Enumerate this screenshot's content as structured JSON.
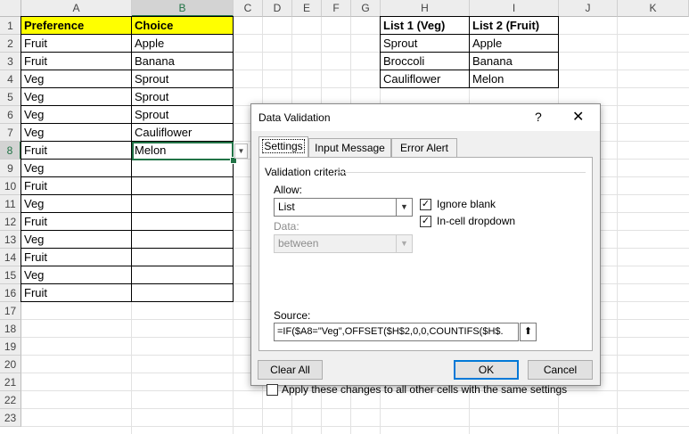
{
  "columns": [
    "A",
    "B",
    "C",
    "D",
    "E",
    "F",
    "G",
    "H",
    "I",
    "J",
    "K"
  ],
  "selected_column": "B",
  "selected_row": 8,
  "rows": [
    1,
    2,
    3,
    4,
    5,
    6,
    7,
    8,
    9,
    10,
    11,
    12,
    13,
    14,
    15,
    16,
    17,
    18,
    19,
    20,
    21,
    22,
    23
  ],
  "sheet": {
    "A1": "Preference",
    "B1": "Choice",
    "A2": "Fruit",
    "B2": "Apple",
    "A3": "Fruit",
    "B3": "Banana",
    "A4": "Veg",
    "B4": "Sprout",
    "A5": "Veg",
    "B5": "Sprout",
    "A6": "Veg",
    "B6": "Sprout",
    "A7": "Veg",
    "B7": "Cauliflower",
    "A8": "Fruit",
    "B8": "Melon",
    "A9": "Veg",
    "A10": "Fruit",
    "A11": "Veg",
    "A12": "Fruit",
    "A13": "Veg",
    "A14": "Fruit",
    "A15": "Veg",
    "A16": "Fruit",
    "H1": "List 1 (Veg)",
    "I1": "List 2 (Fruit)",
    "H2": "Sprout",
    "I2": "Apple",
    "H3": "Broccoli",
    "I3": "Banana",
    "H4": "Cauliflower",
    "I4": "Melon"
  },
  "dialog": {
    "title": "Data Validation",
    "help": "?",
    "close": "✕",
    "tabs": [
      "Settings",
      "Input Message",
      "Error Alert"
    ],
    "active_tab": "Settings",
    "group_label": "Validation criteria",
    "allow_label": "Allow:",
    "allow_value": "List",
    "data_label": "Data:",
    "data_value": "between",
    "ignore_blank_label": "Ignore blank",
    "ignore_blank_checked": true,
    "in_cell_dropdown_label": "In-cell dropdown",
    "in_cell_dropdown_checked": true,
    "source_label": "Source:",
    "source_value": "=IF($A8=\"Veg\",OFFSET($H$2,0,0,COUNTIFS($H$.",
    "apply_all_label": "Apply these changes to all other cells with the same settings",
    "apply_all_checked": false,
    "clear_all": "Clear All",
    "ok": "OK",
    "cancel": "Cancel"
  },
  "colors": {
    "header_fill": "#ffff00",
    "selection": "#217346",
    "dialog_bg": "#f0f0f0",
    "default_button_border": "#0078d7"
  }
}
